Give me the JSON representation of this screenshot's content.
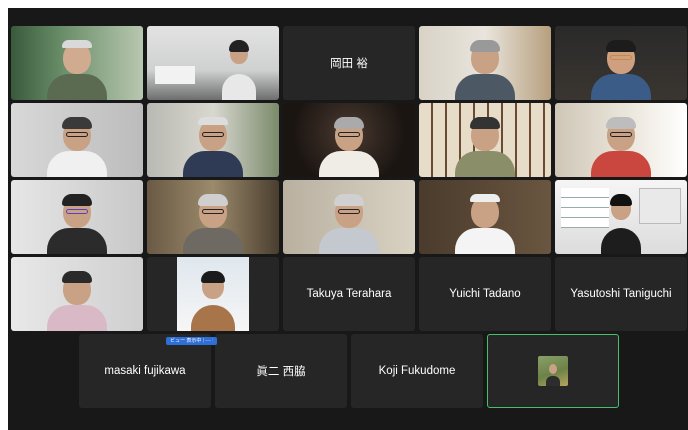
{
  "meeting": {
    "participants_row1": [
      {
        "id": "p1",
        "name": ""
      },
      {
        "id": "p2",
        "name": ""
      },
      {
        "id": "p3",
        "name": "岡田 裕"
      },
      {
        "id": "p4",
        "name": ""
      },
      {
        "id": "p5",
        "name": ""
      }
    ],
    "participants_row4": [
      {
        "id": "p16",
        "name": ""
      },
      {
        "id": "p17",
        "name": ""
      },
      {
        "id": "p18",
        "name": "Takuya Terahara"
      },
      {
        "id": "p19",
        "name": "Yuichi Tadano"
      },
      {
        "id": "p20",
        "name": "Yasutoshi Taniguchi"
      }
    ],
    "participants_row5": [
      {
        "id": "p21",
        "name": "masaki fujikawa"
      },
      {
        "id": "p22",
        "name": "眞二 西脇"
      },
      {
        "id": "p23",
        "name": "Koji Fukudome"
      },
      {
        "id": "p24",
        "name": ""
      }
    ],
    "badge_label": "ビュー 表示中 音声",
    "badge_more": "…"
  }
}
